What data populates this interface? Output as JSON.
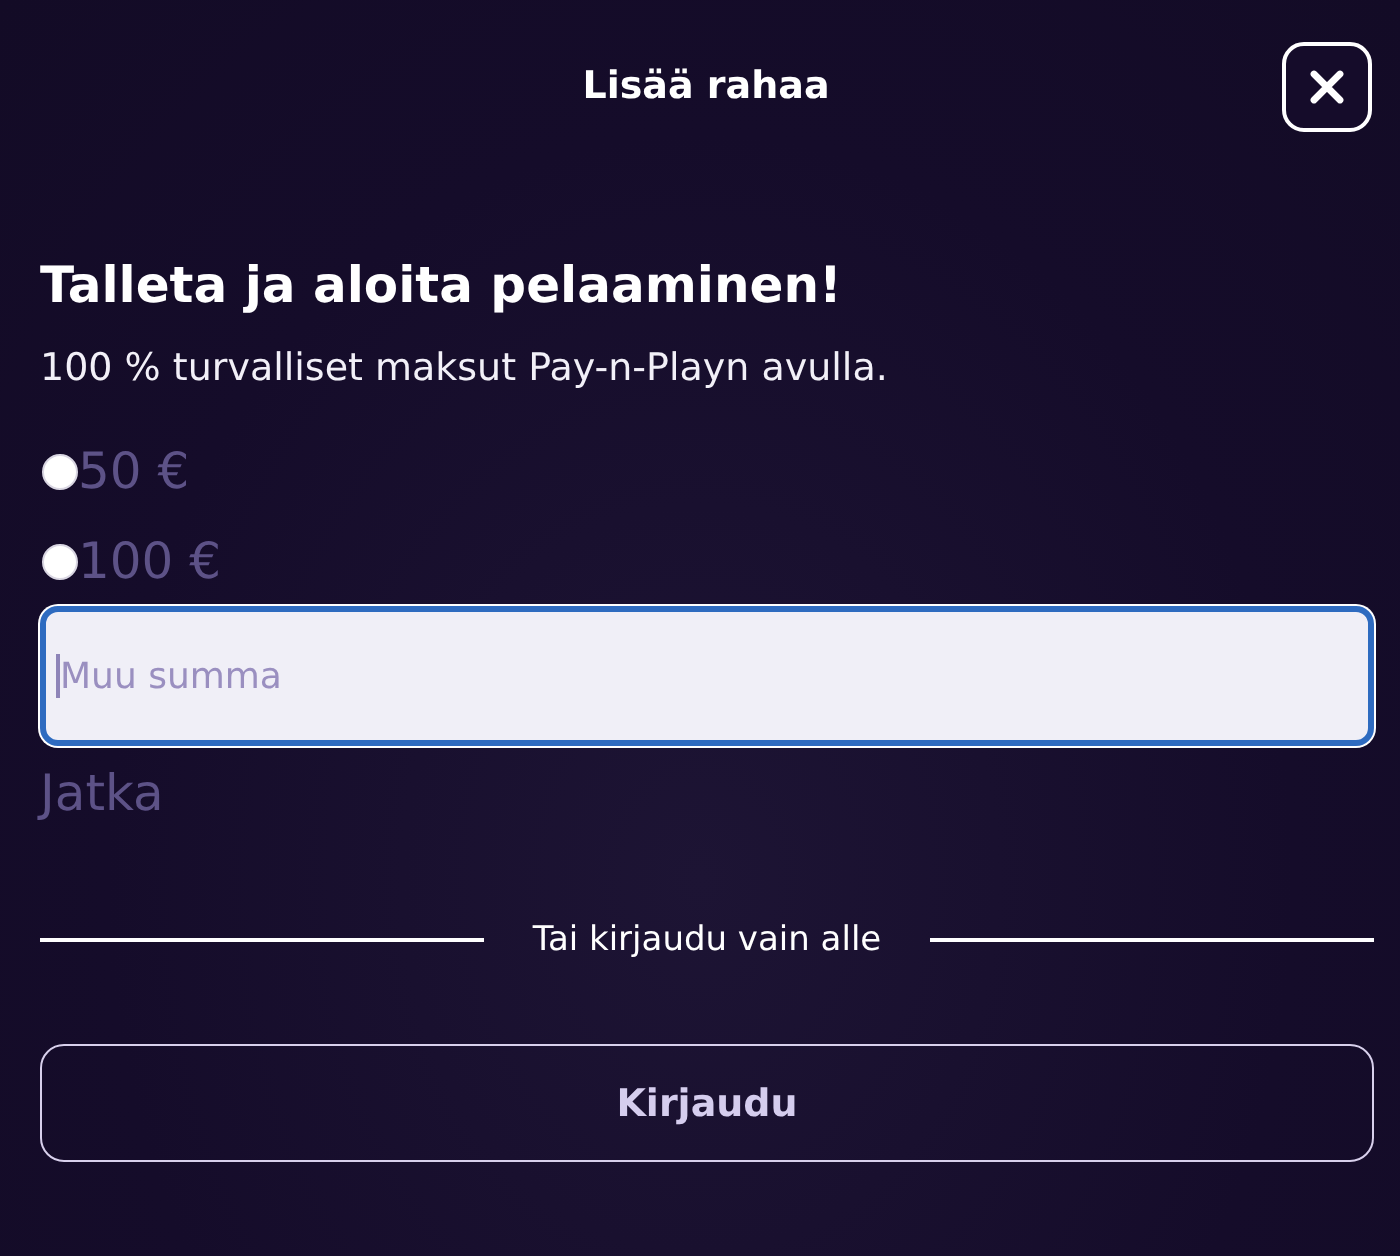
{
  "header": {
    "title": "Lisää rahaa"
  },
  "intro": {
    "heading": "Talleta ja aloita pelaaminen!",
    "subtitle": "100 % turvalliset maksut Pay-n-Playn avulla."
  },
  "amount_options": [
    {
      "label": "50 €",
      "selected": false
    },
    {
      "label": "100 €",
      "selected": false
    }
  ],
  "custom_amount": {
    "placeholder": "Muu summa",
    "focused": true
  },
  "continue_button": {
    "label": "Jatka",
    "disabled": true
  },
  "divider": {
    "text": "Tai kirjaudu vain alle"
  },
  "login_button": {
    "label": "Kirjaudu"
  }
}
